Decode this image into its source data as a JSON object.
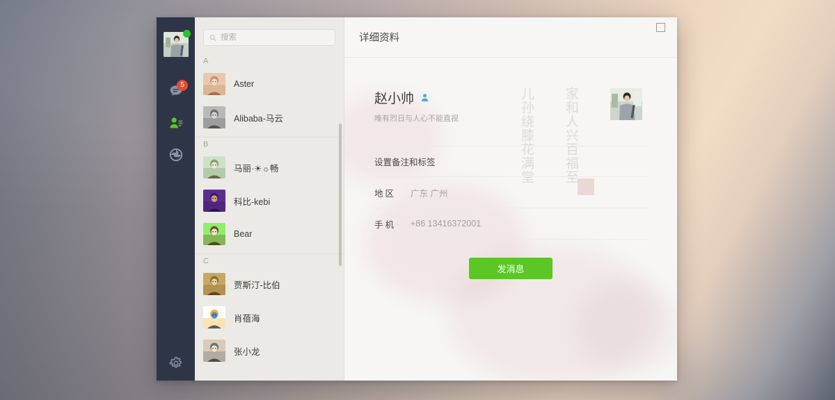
{
  "window": {
    "maximize_icon": "maximize-square-icon"
  },
  "nav": {
    "me_avatar_icon": "user-photo-avatar",
    "online_status_icon": "online-green-dot",
    "items": [
      {
        "id": "chats",
        "icon": "chat-bubble-icon",
        "badge": "5",
        "active": false
      },
      {
        "id": "contacts",
        "icon": "contacts-person-icon",
        "badge": "",
        "active": true
      },
      {
        "id": "moments",
        "icon": "camera-aperture-icon",
        "badge": "",
        "active": false
      }
    ],
    "settings": {
      "id": "settings",
      "icon": "gear-icon"
    }
  },
  "search": {
    "icon": "search-icon",
    "placeholder": "搜索",
    "value": ""
  },
  "contacts": {
    "groups": [
      {
        "letter": "A",
        "items": [
          {
            "name": "Aster",
            "avatar_icon": "avatar-aster"
          },
          {
            "name": "Alibaba-马云",
            "avatar_icon": "avatar-mayun"
          }
        ]
      },
      {
        "letter": "B",
        "items": [
          {
            "name": "马丽·☀☼畅",
            "avatar_icon": "avatar-mali"
          },
          {
            "name": "科比-kebi",
            "avatar_icon": "avatar-kebi"
          },
          {
            "name": "Bear",
            "avatar_icon": "avatar-bear"
          }
        ]
      },
      {
        "letter": "C",
        "items": [
          {
            "name": "贾斯汀-比伯",
            "avatar_icon": "avatar-justin"
          },
          {
            "name": "肖蓓海",
            "avatar_icon": "avatar-xiaobeihai"
          },
          {
            "name": "张小龙",
            "avatar_icon": "avatar-zhangxiaolong"
          }
        ]
      }
    ]
  },
  "detail": {
    "title": "详细资料",
    "profile": {
      "name": "赵小帅",
      "gender_icon": "male-gender-icon",
      "signature": "唯有烈日与人心不能直视",
      "avatar_icon": "avatar-zhaoxiaoshuai"
    },
    "rows": [
      {
        "type": "single",
        "label": "设置备注和标签",
        "value": ""
      },
      {
        "type": "pair",
        "label": "地区",
        "value": "广东 广州"
      },
      {
        "type": "pair",
        "label": "手机",
        "value": "+86 13416372001"
      }
    ],
    "send_button": "发消息",
    "watermark": {
      "column_right": "家和人兴百福至",
      "column_left": "儿孙绕膝花满堂",
      "seal_icon": "red-seal-stamp"
    }
  },
  "colors": {
    "nav_bg": "#2e3547",
    "accent_green": "#5ac725",
    "badge_red": "#e94b35",
    "list_bg": "#eceae7",
    "panel_bg": "#f7f6f4",
    "gender_blue": "#4aa8e0"
  }
}
